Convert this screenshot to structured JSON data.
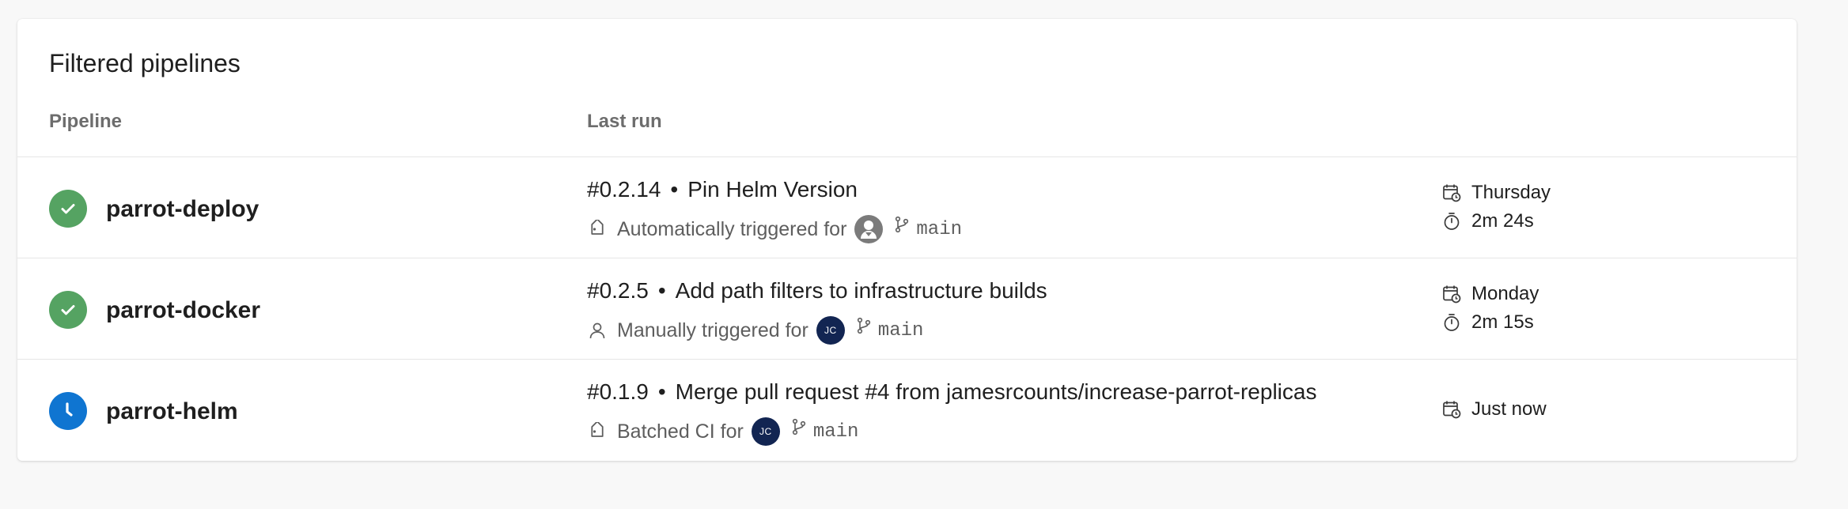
{
  "card": {
    "title": "Filtered pipelines",
    "headers": {
      "pipeline": "Pipeline",
      "last_run": "Last run"
    }
  },
  "colors": {
    "success": "#55a362",
    "running": "#0f75d1",
    "avatar_navy": "#122552"
  },
  "pipelines": [
    {
      "name": "parrot-deploy",
      "status": "success",
      "status_icon": "check-icon",
      "run_number": "#0.2.14",
      "separator": "•",
      "run_title": "Pin Helm Version",
      "trigger_icon": "tag-icon",
      "trigger_text": "Automatically triggered for",
      "avatar_initials": "",
      "branch": "main",
      "date": "Thursday",
      "duration": "2m 24s"
    },
    {
      "name": "parrot-docker",
      "status": "success",
      "status_icon": "check-icon",
      "run_number": "#0.2.5",
      "separator": "•",
      "run_title": "Add path filters to infrastructure builds",
      "trigger_icon": "person-icon",
      "trigger_text": "Manually triggered for",
      "avatar_initials": "JC",
      "branch": "main",
      "date": "Monday",
      "duration": "2m 15s"
    },
    {
      "name": "parrot-helm",
      "status": "running",
      "status_icon": "clock-icon",
      "run_number": "#0.1.9",
      "separator": "•",
      "run_title": "Merge pull request #4 from jamesrcounts/increase-parrot-replicas",
      "trigger_icon": "tag-icon",
      "trigger_text": "Batched CI for",
      "avatar_initials": "JC",
      "branch": "main",
      "date": "Just now",
      "duration": ""
    }
  ]
}
